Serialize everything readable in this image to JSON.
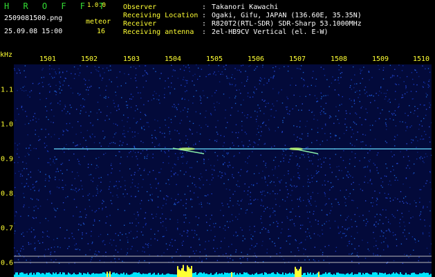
{
  "header": {
    "brand_title": "H R O F F T",
    "brand_version": "1.0.0",
    "filename": "2509081500.png",
    "timestamp": "25.09.08 15:00",
    "meteor_label": "meteor",
    "meteor_count": "16"
  },
  "info": {
    "observer_label": "Observer",
    "observer_value": "Takanori Kawachi",
    "location_label": "Receiving Location",
    "location_value": "Ogaki, Gifu, JAPAN (136.60E, 35.35N)",
    "receiver_label": "Receiver",
    "receiver_value": "R820T2(RTL-SDR) SDR-Sharp 53.1000MHz",
    "antenna_label": "Receiving antenna",
    "antenna_value": "2el-HB9CV Vertical (el. E-W)",
    "colon": ":"
  },
  "axes": {
    "y_unit": "kHz",
    "x_ticks": [
      "1501",
      "1502",
      "1503",
      "1504",
      "1505",
      "1506",
      "1507",
      "1508",
      "1509",
      "1510"
    ],
    "y_ticks": [
      "1.1",
      "1.0",
      "0.9",
      "0.8",
      "0.7",
      "0.6"
    ]
  },
  "colors": {
    "label_green": "#33dd33",
    "value_white": "#ffffff",
    "highlight_yellow": "#ffff33",
    "background_blue": "#030a3a",
    "carrier_cyan": "#66ddff",
    "activity_cyan": "#00e5ff"
  }
}
